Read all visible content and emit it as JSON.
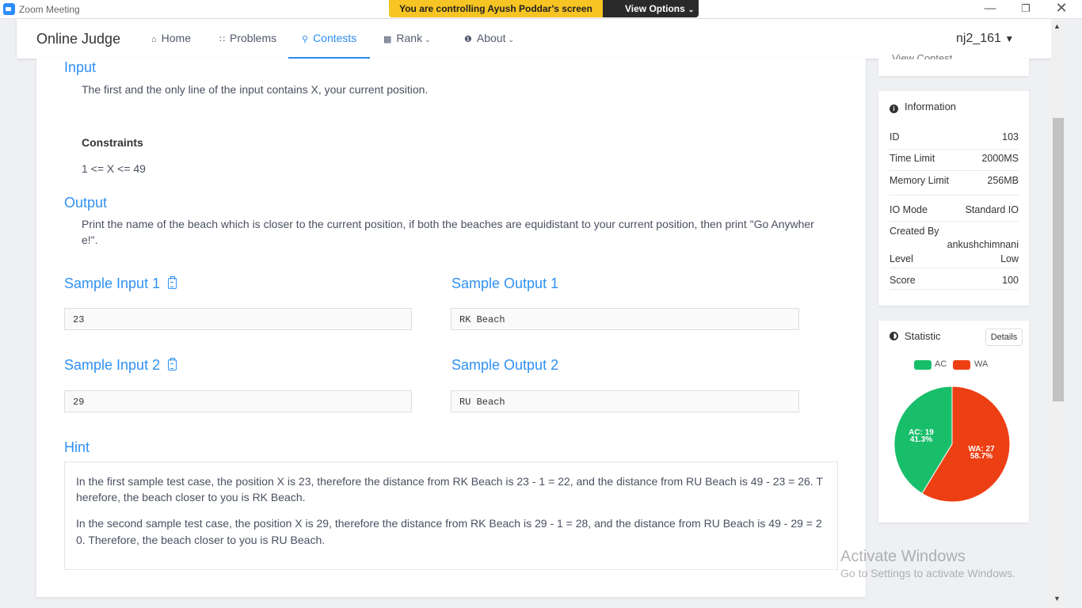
{
  "zoom": {
    "title": "Zoom Meeting",
    "control_banner": "You are controlling Ayush Poddar's screen",
    "view_options": "View Options"
  },
  "navbar": {
    "brand": "Online Judge",
    "items": [
      {
        "label": "Home",
        "icon": "home-icon"
      },
      {
        "label": "Problems",
        "icon": "grid-icon"
      },
      {
        "label": "Contests",
        "icon": "trophy-icon"
      },
      {
        "label": "Rank",
        "icon": "bar-chart-icon"
      },
      {
        "label": "About",
        "icon": "info-icon"
      }
    ],
    "active": "Contests",
    "user": "nj2_161"
  },
  "problem": {
    "input_title": "Input",
    "input_text": "The first and the only line of the input contains X, your current position.",
    "constraints_title": "Constraints",
    "constraints_text": "1 <= X <= 49",
    "output_title": "Output",
    "output_text_line1": "Print the name of the beach which is closer to the current position, if both the beaches are equidistant to your current position, then print \"Go Anywher",
    "output_text_line2": "e!\".",
    "samples": [
      {
        "input_label": "Sample Input 1",
        "input": "23",
        "output_label": "Sample Output 1",
        "output": "RK Beach"
      },
      {
        "input_label": "Sample Input 2",
        "input": "29",
        "output_label": "Sample Output 2",
        "output": "RU Beach"
      }
    ],
    "hint_title": "Hint",
    "hint_p1_line1": "In the first sample test case, the position X is 23, therefore the distance from RK Beach is 23 - 1 = 22, and the distance from RU Beach is 49 - 23 = 26. T",
    "hint_p1_line2": "herefore, the beach closer to you is RK Beach.",
    "hint_p2_line1": "In the second sample test case, the position X is 29, therefore the distance from RK Beach is 29 - 1 = 28, and the distance from RU Beach is 49 - 29 = 2",
    "hint_p2_line2": "0. Therefore, the beach closer to you is RU Beach."
  },
  "sidebar": {
    "view_contest": "View Contest",
    "info_title": "Information",
    "info": {
      "id_label": "ID",
      "id": "103",
      "time_label": "Time Limit",
      "time": "2000MS",
      "memory_label": "Memory Limit",
      "memory": "256MB",
      "io_label": "IO Mode",
      "io": "Standard IO",
      "created_label": "Created By",
      "created": "ankushchimnani",
      "level_label": "Level",
      "level": "Low",
      "score_label": "Score",
      "score": "100"
    },
    "statistic_title": "Statistic",
    "details_btn": "Details",
    "legend": {
      "ac": "AC",
      "wa": "WA"
    },
    "labels": {
      "ac_count": "AC: 19",
      "ac_pct": "41.3%",
      "wa_count": "WA: 27",
      "wa_pct": "58.7%"
    }
  },
  "chart_data": {
    "type": "pie",
    "categories": [
      "AC",
      "WA"
    ],
    "values": [
      19,
      27
    ],
    "percent": [
      41.3,
      58.7
    ],
    "colors": [
      "#19be6b",
      "#ed3f14"
    ],
    "legend": "top"
  },
  "watermark": {
    "line1": "Activate Windows",
    "line2": "Go to Settings to activate Windows."
  }
}
